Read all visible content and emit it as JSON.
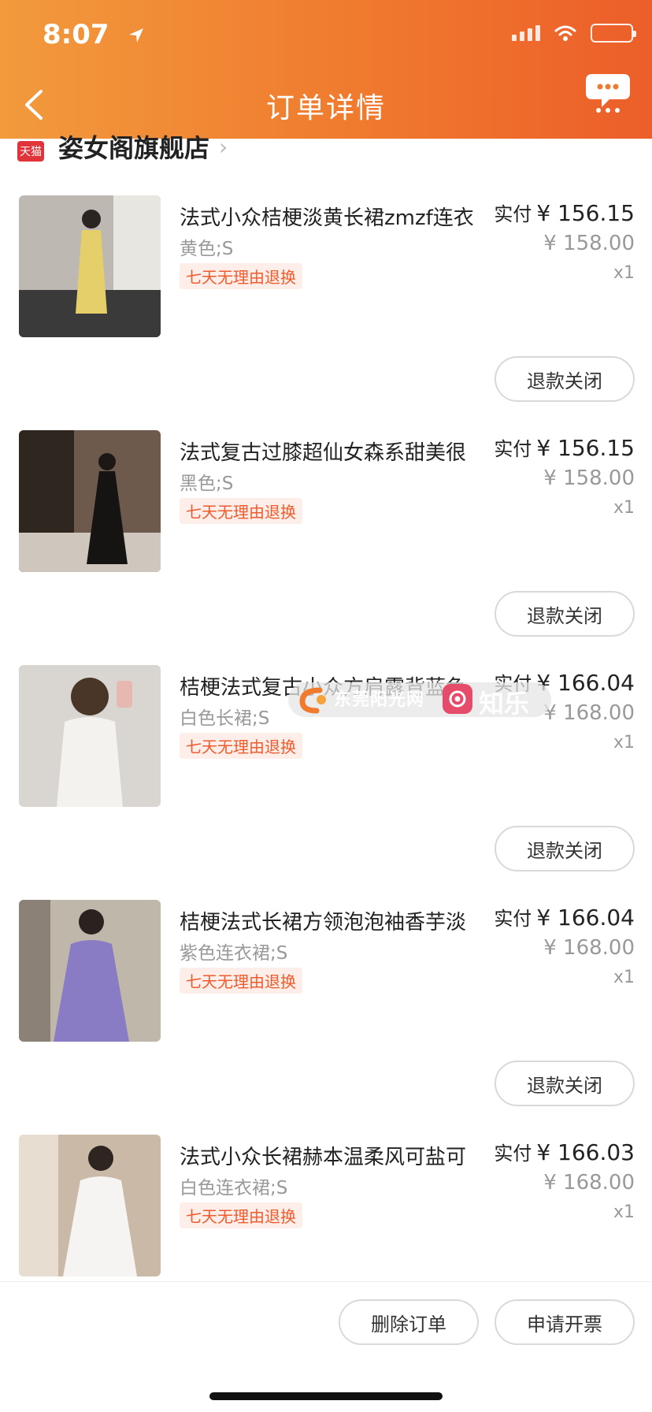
{
  "status_bar": {
    "time": "8:07"
  },
  "nav": {
    "title": "订单详情"
  },
  "store": {
    "badge": "天猫",
    "name": "姿女阁旗舰店"
  },
  "items": [
    {
      "title": "法式小众桔梗淡黄长裙zmzf连衣",
      "sku": "黄色;S",
      "tag": "七天无理由退换",
      "paid_label": "实付",
      "paid": "¥ 156.15",
      "original": "¥ 158.00",
      "qty": "x1",
      "action": "退款关闭"
    },
    {
      "title": "法式复古过膝超仙女森系甜美很",
      "sku": "黑色;S",
      "tag": "七天无理由退换",
      "paid_label": "实付",
      "paid": "¥ 156.15",
      "original": "¥ 158.00",
      "qty": "x1",
      "action": "退款关闭"
    },
    {
      "title": "桔梗法式复古小众方肩露背蓝色",
      "sku": "白色长裙;S",
      "tag": "七天无理由退换",
      "paid_label": "实付",
      "paid": "¥ 166.04",
      "original": "¥ 168.00",
      "qty": "x1",
      "action": "退款关闭"
    },
    {
      "title": "桔梗法式长裙方领泡泡袖香芋淡",
      "sku": "紫色连衣裙;S",
      "tag": "七天无理由退换",
      "paid_label": "实付",
      "paid": "¥ 166.04",
      "original": "¥ 168.00",
      "qty": "x1",
      "action": "退款关闭"
    },
    {
      "title": "法式小众长裙赫本温柔风可盐可",
      "sku": "白色连衣裙;S",
      "tag": "七天无理由退换",
      "paid_label": "实付",
      "paid": "¥ 166.03",
      "original": "¥ 168.00",
      "qty": "x1"
    }
  ],
  "watermark": {
    "text1": "东莞阳光网",
    "text2": "知乐云"
  },
  "footer": {
    "delete_label": "删除订单",
    "invoice_label": "申请开票"
  },
  "colors": {
    "header_start": "#f29a3d",
    "header_end": "#ec5e2a",
    "tag_text": "#f05b2d",
    "tag_bg": "#fdeee9"
  }
}
